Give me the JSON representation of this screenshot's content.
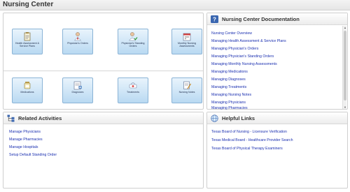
{
  "window": {
    "title": "Nursing Center"
  },
  "tiles": {
    "row1": [
      {
        "label": "Health Assessment & Service Plans",
        "icon": "clipboard-icon"
      },
      {
        "label": "Physician's Orders",
        "icon": "physician-icon"
      },
      {
        "label": "Physician's Standing Orders",
        "icon": "physician-check-icon"
      },
      {
        "label": "Monthly Nursing Assessments",
        "icon": "calendar-icon"
      }
    ],
    "row2": [
      {
        "label": "Medications",
        "icon": "medication-icon"
      },
      {
        "label": "Diagnoses",
        "icon": "diagnosis-icon"
      },
      {
        "label": "Treatments",
        "icon": "treatment-icon"
      },
      {
        "label": "Nursing Notes",
        "icon": "notes-icon"
      }
    ]
  },
  "documentation": {
    "title": "Nursing Center Documentation",
    "links": [
      "Nursing Center Overview",
      "Managing Health Assessment & Service Plans",
      "Managing Physician's Orders",
      "Managing Physician's Standing Orders",
      "Managing Monthly Nursing Assessments",
      "Managing Medications",
      "Managing Diagnoses",
      "Managing Treatments",
      "Managing Nursing Notes",
      "Managing Physicians",
      "Managing Pharmacies"
    ]
  },
  "related": {
    "title": "Related Activities",
    "links": [
      "Manage Physicians",
      "Manage Pharmacies",
      "Manage Hospitals",
      "Setup Default Standing Order"
    ]
  },
  "helpful": {
    "title": "Helpful Links",
    "links": [
      "Texas Board of Nursing - Licensure Verification",
      "Texas Medical Board - Healthcare Provider Search",
      "Texas Board of Physical Therapy Examiners"
    ]
  },
  "colors": {
    "link": "#1a2fb0",
    "tile_border": "#8ab3d6",
    "help_icon": "#3a66b0"
  }
}
